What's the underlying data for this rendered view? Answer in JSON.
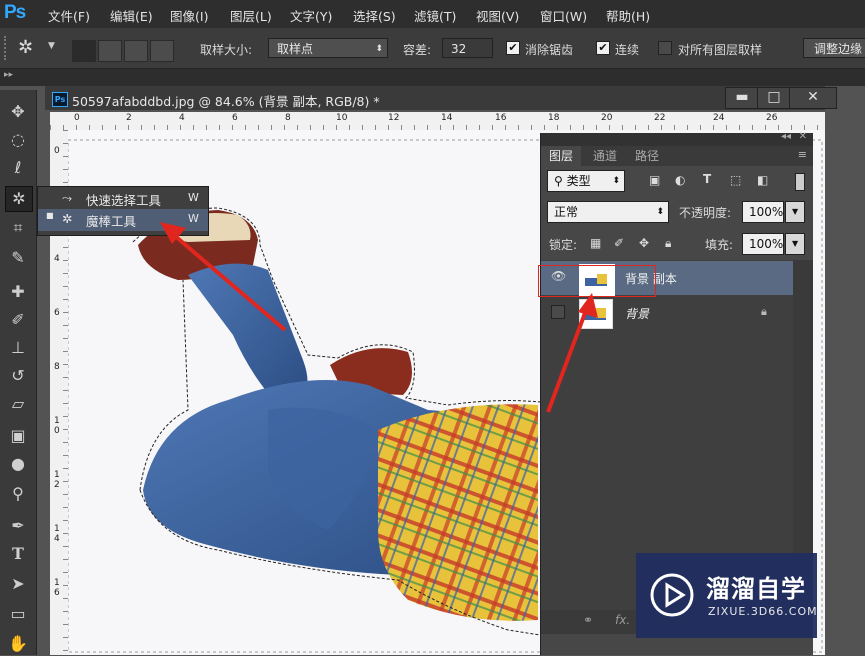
{
  "app": {
    "logo": "Ps"
  },
  "menubar": {
    "items": [
      "文件(F)",
      "编辑(E)",
      "图像(I)",
      "图层(L)",
      "文字(Y)",
      "选择(S)",
      "滤镜(T)",
      "视图(V)",
      "窗口(W)",
      "帮助(H)"
    ]
  },
  "options": {
    "sample_size_label": "取样大小:",
    "sample_size_value": "取样点",
    "tolerance_label": "容差:",
    "tolerance_value": "32",
    "antialias_label": "消除锯齿",
    "antialias_checked": true,
    "contiguous_label": "连续",
    "contiguous_checked": true,
    "sample_all_label": "对所有图层取样",
    "sample_all_checked": false,
    "refine_edge_label": "调整边缘"
  },
  "document": {
    "title": "50597afabddbd.jpg @ 84.6% (背景 副本, RGB/8) *",
    "icon": "Ps"
  },
  "window_controls": {
    "minimize": "▬",
    "restore": "□",
    "close": "✕"
  },
  "rulers": {
    "h_marks": [
      "0",
      "2",
      "4",
      "6",
      "8",
      "10",
      "12",
      "14",
      "16",
      "18",
      "20",
      "22",
      "24",
      "26"
    ],
    "v_marks": [
      "0",
      "2",
      "4",
      "6",
      "8",
      "1\n0",
      "1\n2",
      "1\n4",
      "1\n6"
    ]
  },
  "tools": [
    "move-icon",
    "marquee-icon",
    "lasso-icon",
    "magic-wand-icon",
    "crop-icon",
    "eyedropper-icon",
    "healing-icon",
    "brush-icon",
    "stamp-icon",
    "history-brush-icon",
    "eraser-icon",
    "gradient-icon",
    "blur-icon",
    "dodge-icon",
    "pen-icon",
    "type-icon",
    "path-select-icon",
    "shape-icon",
    "hand-icon"
  ],
  "flyout": {
    "items": [
      {
        "label": "快速选择工具",
        "shortcut": "W",
        "active": false
      },
      {
        "label": "魔棒工具",
        "shortcut": "W",
        "active": true
      }
    ]
  },
  "layers_panel": {
    "tabs": [
      "图层",
      "通道",
      "路径"
    ],
    "active_tab": "图层",
    "filter_kind": "类型",
    "blend_mode": "正常",
    "opacity_label": "不透明度:",
    "opacity_value": "100%",
    "lock_label": "锁定:",
    "fill_label": "填充:",
    "fill_value": "100%",
    "layers": [
      {
        "name": "背景 副本",
        "visible": true,
        "selected": true,
        "locked": false
      },
      {
        "name": "背景",
        "visible": false,
        "selected": false,
        "locked": true
      }
    ],
    "footer": [
      "link-icon",
      "fx-icon"
    ]
  },
  "watermark": {
    "title": "溜溜自学",
    "url": "ZIXUE.3D66.COM"
  },
  "colors": {
    "accent": "#31a8ff",
    "selection_row": "#596a82",
    "annotation": "#e0261e"
  }
}
